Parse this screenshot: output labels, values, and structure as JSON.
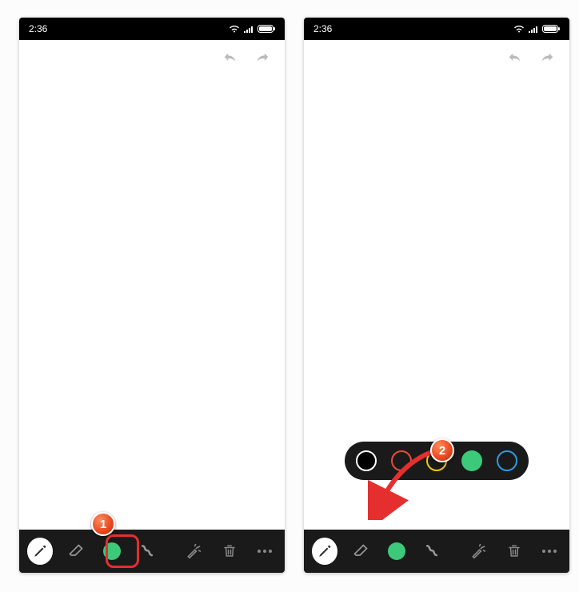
{
  "statusbar": {
    "time": "2:36"
  },
  "colors": {
    "green": "#3cc97a",
    "black": "#000000",
    "red": "#e74c3c",
    "yellow": "#f1c40f",
    "blue": "#3498db"
  },
  "badges": {
    "one": "1",
    "two": "2"
  },
  "toolbar": {
    "pencil": "pencil",
    "eraser": "eraser",
    "color": "color",
    "shape": "shape",
    "effects": "effects",
    "delete": "delete",
    "more": "more"
  },
  "header": {
    "undo": "undo",
    "redo": "redo"
  }
}
